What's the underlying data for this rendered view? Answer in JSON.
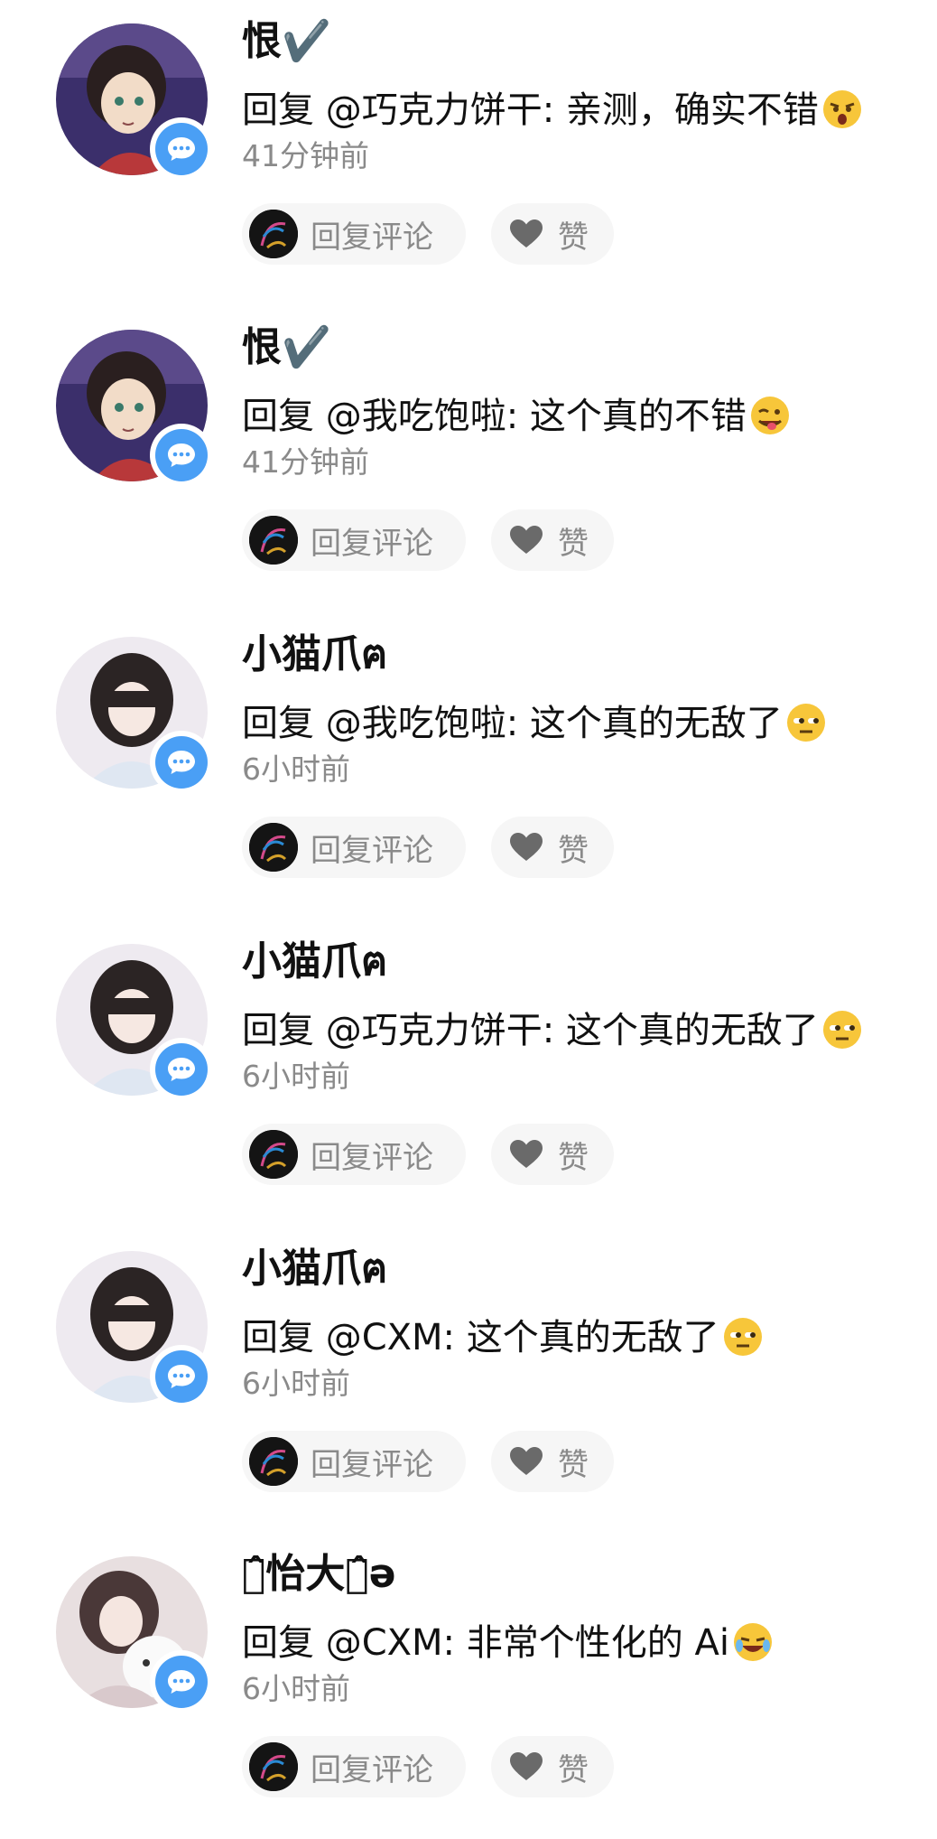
{
  "buttons": {
    "reply_label": "回复评论",
    "like_label": "赞"
  },
  "icons": {
    "badge": "chat-bubble-icon",
    "like": "heart-icon",
    "reply_avatar": "dark-avatar"
  },
  "colors": {
    "badge_blue": "#4a9ff5",
    "secondary_text": "#8a8a8a",
    "button_bg": "#f6f6f6"
  },
  "comments": [
    {
      "name": "恨✔️",
      "reply": "回复 @巧克力饼干: 亲测，确实不错",
      "emoji": "shocked-face",
      "time": "41分钟前",
      "avatar": "anime-girl-purple"
    },
    {
      "name": "恨✔️",
      "reply": "回复 @我吃饱啦: 这个真的不错",
      "emoji": "winking-tongue-face",
      "time": "41分钟前",
      "avatar": "anime-girl-purple"
    },
    {
      "name": "小猫爪ฅ",
      "reply": "回复 @我吃饱啦: 这个真的无敌了",
      "emoji": "unamused-face",
      "time": "6小时前",
      "avatar": "doll-girl-white"
    },
    {
      "name": "小猫爪ฅ",
      "reply": "回复 @巧克力饼干: 这个真的无敌了",
      "emoji": "unamused-face",
      "time": "6小时前",
      "avatar": "doll-girl-white"
    },
    {
      "name": "小猫爪ฅ",
      "reply": "回复 @CXM: 这个真的无敌了",
      "emoji": "unamused-face",
      "time": "6小时前",
      "avatar": "doll-girl-white"
    },
    {
      "name": "小̂怡大主̂ə",
      "reply": "回复 @CXM: 非常个性化的 Ai",
      "emoji": "tears-of-joy-face",
      "time": "6小时前",
      "avatar": "girl-with-plush"
    }
  ]
}
